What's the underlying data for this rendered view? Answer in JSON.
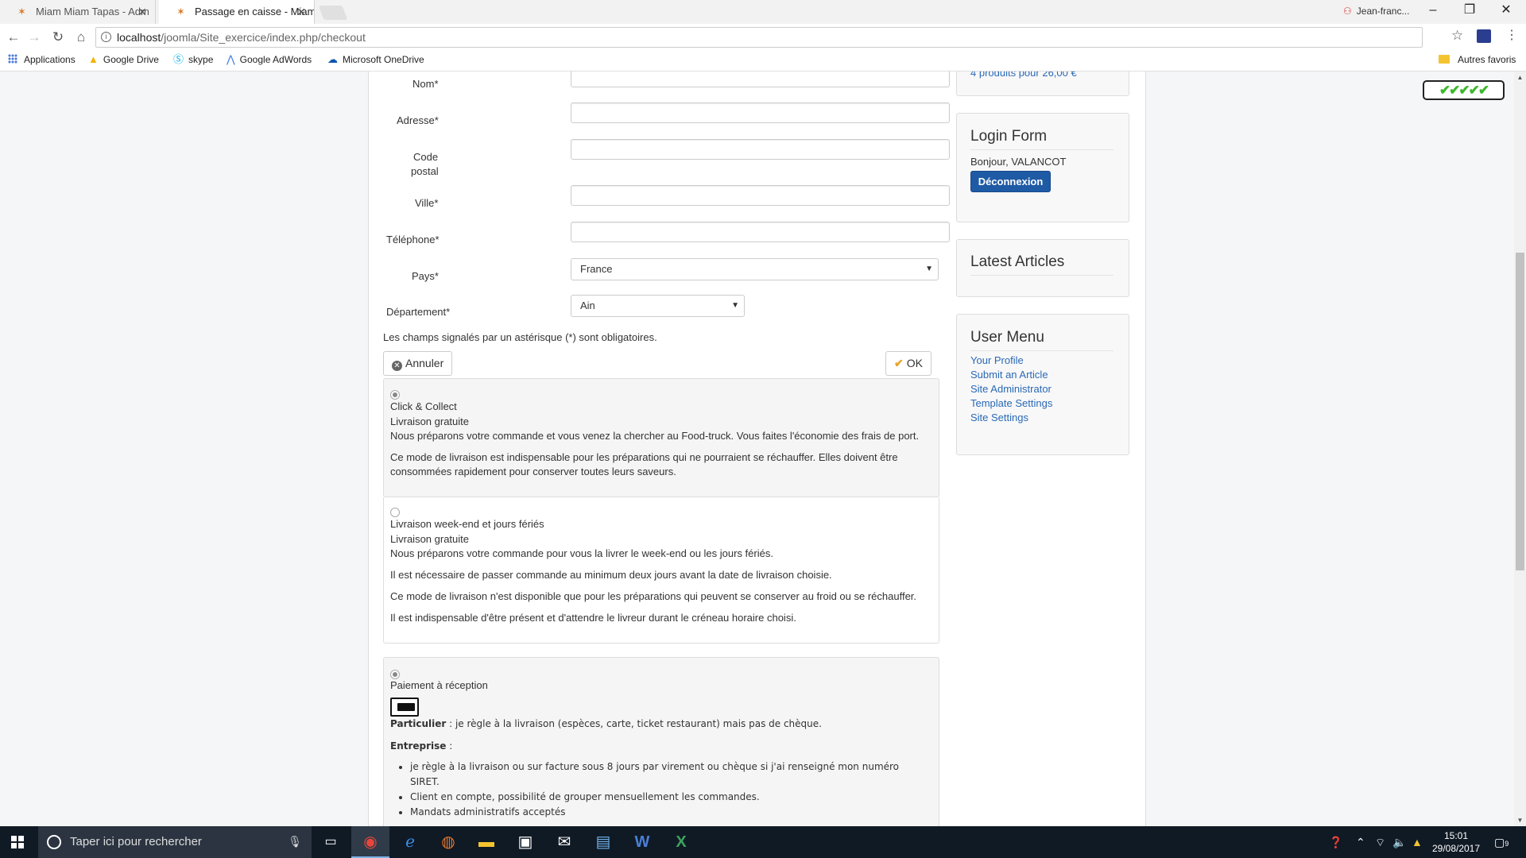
{
  "browser": {
    "tabs": [
      {
        "title": "Miam Miam Tapas - Adm",
        "active": false
      },
      {
        "title": "Passage en caisse - Miam",
        "active": true
      }
    ],
    "profile_name": "Jean-franc...",
    "url_host": "localhost",
    "url_path": "/joomla/Site_exercice/index.php/checkout",
    "bookmarks": [
      {
        "label": "Applications",
        "icon": "apps-icon"
      },
      {
        "label": "Google Drive",
        "icon": "google-drive-icon"
      },
      {
        "label": "skype",
        "icon": "skype-icon"
      },
      {
        "label": "Google AdWords",
        "icon": "adwords-icon"
      },
      {
        "label": "Microsoft OneDrive",
        "icon": "onedrive-icon"
      }
    ],
    "other_bookmarks": "Autres favoris"
  },
  "form": {
    "fields": [
      {
        "label": "Nom*",
        "value": ""
      },
      {
        "label": "Adresse*",
        "value": ""
      },
      {
        "label": "Code postal",
        "label_line1": "Code",
        "label_line2": "postal",
        "value": ""
      },
      {
        "label": "Ville*",
        "value": ""
      },
      {
        "label": "Téléphone*",
        "value": ""
      }
    ],
    "country_label": "Pays*",
    "country_value": "France",
    "department_label": "Département*",
    "department_value": "Ain",
    "required_note": "Les champs signalés par un astérisque (*) sont obligatoires.",
    "cancel_label": "Annuler",
    "ok_label": "OK"
  },
  "shipping": [
    {
      "selected": true,
      "name": "Click & Collect",
      "price": "Livraison gratuite",
      "lines": [
        "Nous préparons votre commande et vous venez la chercher au Food-truck. Vous faites l'économie des frais de port.",
        "Ce mode de livraison est indispensable pour les préparations qui ne pourraient se réchauffer.  Elles doivent être consommées rapidement pour conserver toutes leurs saveurs."
      ]
    },
    {
      "selected": false,
      "name": "Livraison week-end et jours fériés",
      "price": "Livraison gratuite",
      "lines": [
        "Nous préparons votre commande pour vous la livrer le week-end ou les jours fériés.",
        "Il est nécessaire de passer commande au minimum deux jours avant la date de livraison choisie.",
        "Ce mode de livraison n'est disponible que pour les préparations qui peuvent se conserver au froid ou se réchauffer.",
        "Il est indispensable d'être présent et d'attendre le livreur durant le créneau horaire choisi."
      ]
    }
  ],
  "payment": {
    "selected": true,
    "name": "Paiement à réception",
    "individual_label": "Particulier",
    "individual_text": " : je règle à la livraison (espèces, carte, ticket restaurant) mais pas de chèque.",
    "company_label": "Entreprise",
    "company_suffix": " :",
    "company_items": [
      "je règle à la livraison ou sur facture sous 8 jours par virement ou chèque si j'ai renseigné mon numéro SIRET.",
      "Client en compte, possibilité de grouper mensuellement les commandes.",
      "Mandats administratifs acceptés"
    ]
  },
  "sidebar": {
    "cart_summary": "4 produits pour 26,00 €",
    "login_title": "Login Form",
    "greeting": "Bonjour, VALANCOT",
    "logout_label": "Déconnexion",
    "latest_title": "Latest Articles",
    "user_menu_title": "User Menu",
    "user_menu_items": [
      "Your Profile",
      "Submit an Article",
      "Site Administrator",
      "Template Settings",
      "Site Settings"
    ]
  },
  "badge": "✔✔✔✔✔",
  "taskbar": {
    "search_placeholder": "Taper ici pour rechercher",
    "time": "15:01",
    "date": "29/08/2017",
    "notification_count": "9"
  }
}
